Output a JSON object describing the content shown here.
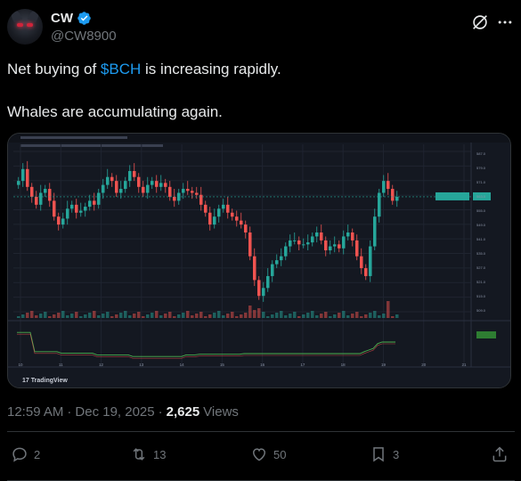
{
  "author": {
    "display_name": "CW",
    "handle": "@CW8900",
    "verified": true,
    "avatar_icon": "devil-avatar"
  },
  "tweet": {
    "line1_before": "Net buying of ",
    "cashtag": "$BCH",
    "line1_after": " is increasing rapidly.",
    "line2": "Whales are accumulating again."
  },
  "meta": {
    "time": "12:59 AM",
    "sep1": "·",
    "date": "Dec 19, 2025",
    "sep2": "·",
    "views_count": "2,625",
    "views_label": "Views"
  },
  "actions": {
    "replies": "2",
    "reposts": "13",
    "likes": "50",
    "bookmarks": "3"
  },
  "chart_data": {
    "type": "candlestick",
    "source_watermark": "TradingView",
    "x_tick_labels": [
      "10",
      "11",
      "12",
      "13",
      "14",
      "15",
      "16",
      "17",
      "18",
      "19",
      "20",
      "21"
    ],
    "close_series": [
      578,
      584,
      575,
      570,
      566,
      572,
      574,
      568,
      560,
      556,
      559,
      564,
      566,
      562,
      563,
      565,
      568,
      566,
      572,
      576,
      580,
      578,
      572,
      574,
      578,
      583,
      580,
      575,
      572,
      576,
      578,
      575,
      577,
      575,
      570,
      568,
      572,
      574,
      573,
      572,
      571,
      566,
      562,
      556,
      560,
      564,
      566,
      562,
      560,
      558,
      556,
      552,
      540,
      528,
      520,
      524,
      530,
      536,
      538,
      540,
      545,
      548,
      548,
      546,
      546,
      547,
      550,
      552,
      548,
      543,
      545,
      546,
      544,
      550,
      552,
      548,
      540,
      534,
      530,
      545,
      560,
      572,
      578,
      574,
      568,
      570
    ],
    "price_axis_ticks": [
      "587.0",
      "579.0",
      "571.0",
      "563.0",
      "555.0",
      "549.0",
      "541.0",
      "535.0",
      "527.0",
      "521.0",
      "515.0",
      "509.0"
    ],
    "colors": {
      "up": "#26a69a",
      "down": "#ef5350",
      "background": "#141821",
      "grid": "#1f2430",
      "indicator": "#4caf50"
    }
  },
  "colors": {
    "accent": "#1d9bf0",
    "text_secondary": "#71767b",
    "divider": "#2f3336"
  }
}
